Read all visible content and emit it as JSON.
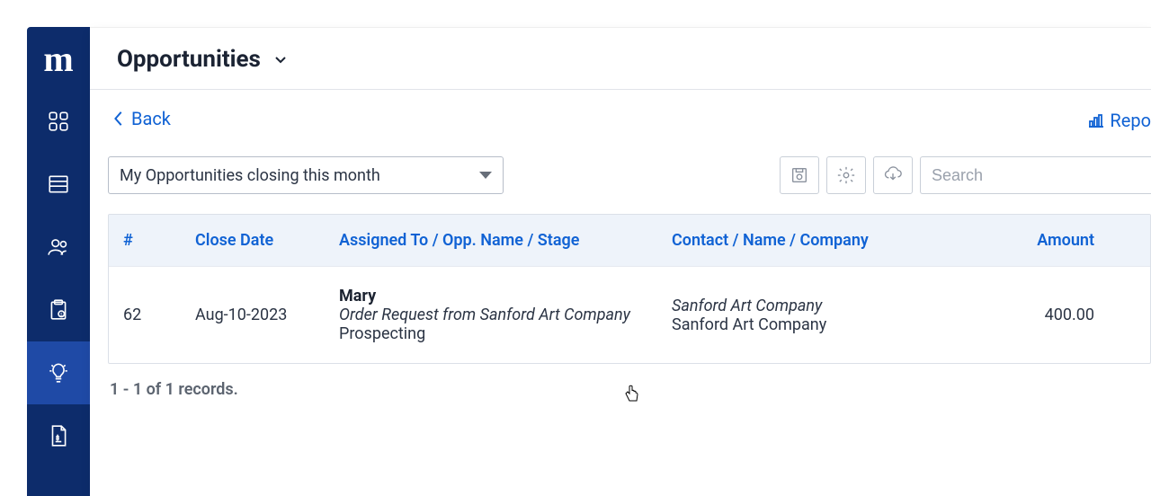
{
  "app": {
    "logo_text": "m"
  },
  "header": {
    "title": "Opportunities"
  },
  "actions": {
    "back_label": "Back",
    "report_label": "Repo"
  },
  "filter": {
    "selected": "My Opportunities closing this month"
  },
  "search": {
    "placeholder": "Search"
  },
  "table": {
    "headers": {
      "idx": "#",
      "close_date": "Close Date",
      "assigned": "Assigned To / Opp. Name / Stage",
      "contact": "Contact / Name / Company",
      "amount": "Amount"
    },
    "rows": [
      {
        "idx": "62",
        "close_date": "Aug-10-2023",
        "assigned_to": "Mary",
        "opp_name": "Order Request from Sanford Art Company",
        "stage": "Prospecting",
        "contact_name": "Sanford Art Company",
        "company": "Sanford Art Company",
        "amount": "400.00"
      }
    ]
  },
  "pagination": {
    "text": "1 - 1 of 1 records."
  }
}
